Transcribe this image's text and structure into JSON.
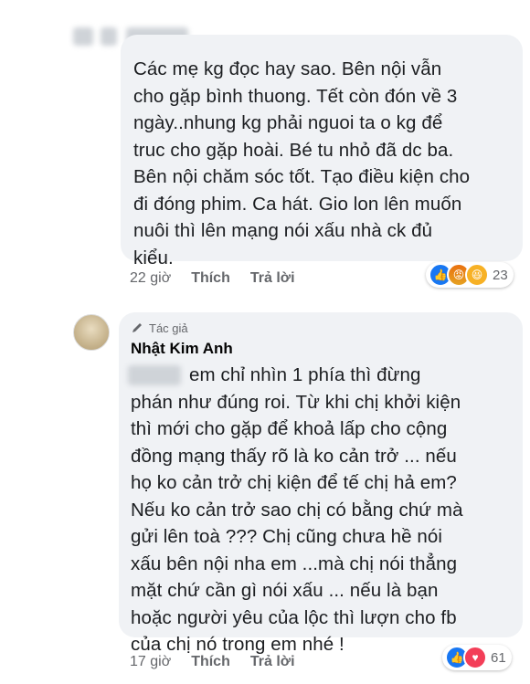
{
  "comment1": {
    "text": "Các mẹ kg đọc hay sao. Bên nội vẫn\ncho gặp bình thuong. Tết còn đón về 3\nngày..nhung kg phải nguoi ta o kg để\ntruc cho gặp hoài. Bé tu nhỏ đã dc ba.\nBên nội chăm sóc tốt. Tạo điều kiện cho\nđi đóng phim. Ca hát. Gio lon lên muốn\nnuôi thì lên mạng nói xấu nhà ck đủ\nkiểu.",
    "time": "22 giờ",
    "like_label": "Thích",
    "reply_label": "Trả lời",
    "reaction_count": "23"
  },
  "comment2": {
    "author_badge": "Tác giả",
    "author_name": "Nhật Kim Anh",
    "text": "em chỉ nhìn 1 phía thì đừng\nphán như đúng roi. Từ khi chị khởi kiện\nthì mới cho gặp để khoả lấp cho cộng\nđồng mạng thấy rõ là ko cản trở ... nếu\nhọ ko cản trở chị kiện để tế chị hả em?\nNếu ko cản trở sao chị có bằng chứ mà\ngửi lên toà ??? Chị cũng chưa hề nói\nxấu bên nội nha em ...mà chị nói thẳng\nmặt chứ cần gì nói xấu ... nếu là bạn\nhoặc người yêu của lộc thì lượn cho fb\ncủa chị nó trong em nhé !",
    "time": "17 giờ",
    "like_label": "Thích",
    "reply_label": "Trả lời",
    "reaction_count": "61"
  },
  "icons": {
    "pen": "pen-icon",
    "like": "like-reaction-icon",
    "angry": "angry-reaction-icon",
    "haha": "haha-reaction-icon",
    "love": "love-reaction-icon"
  },
  "colors": {
    "bubble": "#f0f2f5",
    "meta": "#65676b",
    "like_blue": "#1877f2"
  }
}
